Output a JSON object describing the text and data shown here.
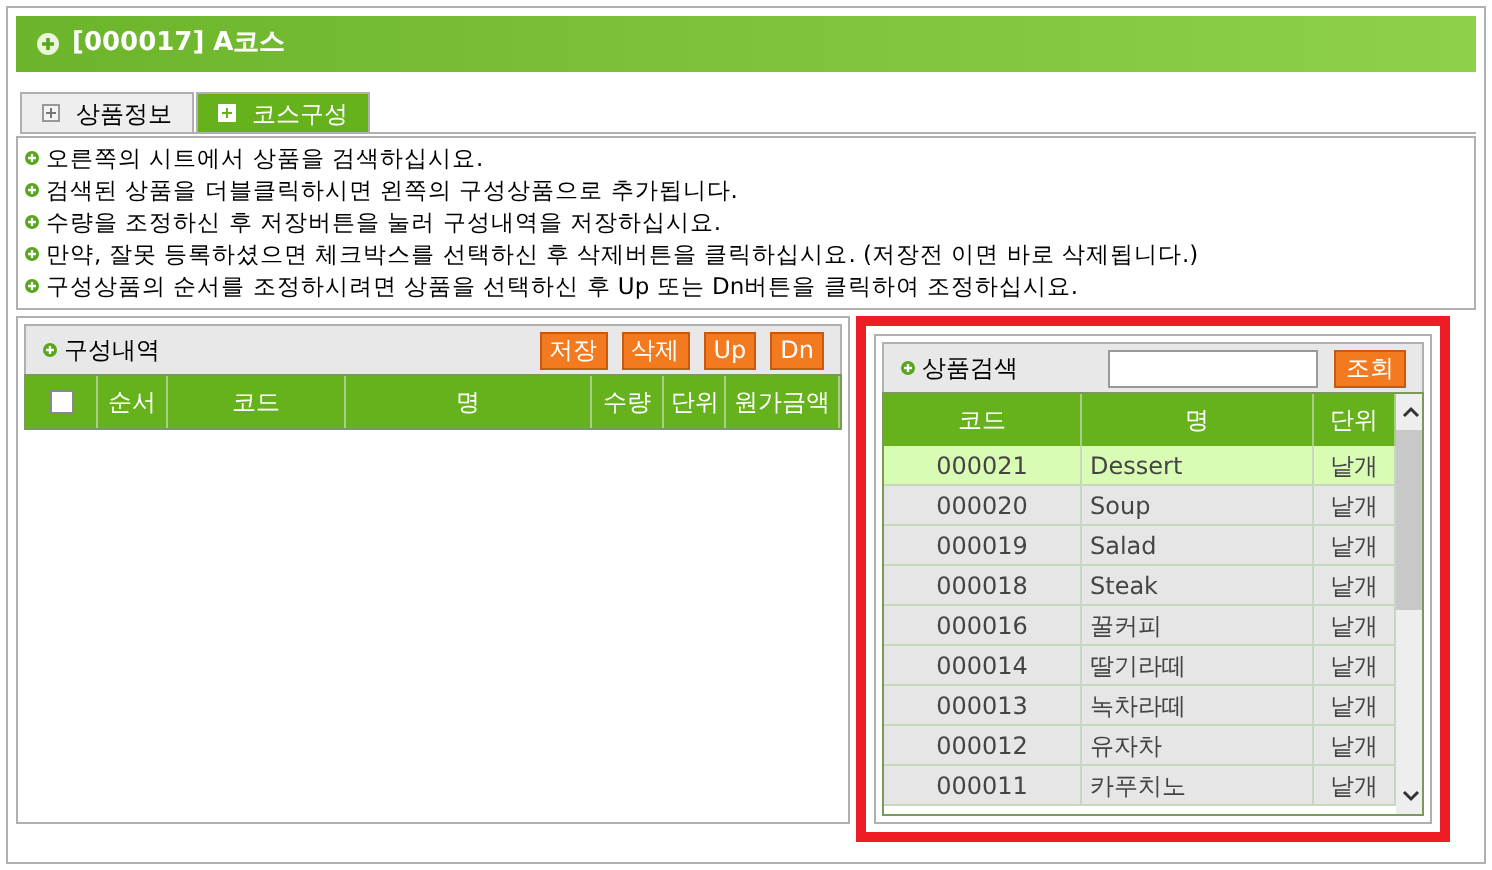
{
  "window": {
    "title": "[000017] A코스"
  },
  "tabs": [
    {
      "label": "상품정보",
      "selected": false
    },
    {
      "label": "코스구성",
      "selected": true
    }
  ],
  "instructions": [
    "오른쪽의 시트에서 상품을 검색하십시요.",
    "검색된 상품을 더블클릭하시면 왼쪽의 구성상품으로 추가됩니다.",
    "수량을 조정하신 후 저장버튼을 눌러 구성내역을 저장하십시요.",
    "만약, 잘못 등록하셨으면 체크박스를 선택하신 후 삭제버튼을 클릭하십시요. (저장전 이면 바로 삭제됩니다.)",
    "구성상품의 순서를 조정하시려면 상품을 선택하신 후 Up 또는 Dn버튼을 클릭하여 조정하십시요."
  ],
  "composition": {
    "title": "구성내역",
    "buttons": [
      "저장",
      "삭제",
      "Up",
      "Dn"
    ],
    "select_all_checked": false,
    "columns": [
      "순서",
      "코드",
      "명",
      "수량",
      "단위",
      "원가금액"
    ]
  },
  "search": {
    "title": "상품검색",
    "button": "조회",
    "columns": [
      "코드",
      "명",
      "단위"
    ],
    "rows": [
      {
        "code": "000021",
        "name": "Dessert",
        "unit": "낱개",
        "selected": true
      },
      {
        "code": "000020",
        "name": "Soup",
        "unit": "낱개",
        "selected": false
      },
      {
        "code": "000019",
        "name": "Salad",
        "unit": "낱개",
        "selected": false
      },
      {
        "code": "000018",
        "name": "Steak",
        "unit": "낱개",
        "selected": false
      },
      {
        "code": "000016",
        "name": "꿀커피",
        "unit": "낱개",
        "selected": false
      },
      {
        "code": "000014",
        "name": "딸기라떼",
        "unit": "낱개",
        "selected": false
      },
      {
        "code": "000013",
        "name": "녹차라떼",
        "unit": "낱개",
        "selected": false
      },
      {
        "code": "000012",
        "name": "유자차",
        "unit": "낱개",
        "selected": false
      },
      {
        "code": "000011",
        "name": "카푸치노",
        "unit": "낱개",
        "selected": false
      }
    ]
  }
}
